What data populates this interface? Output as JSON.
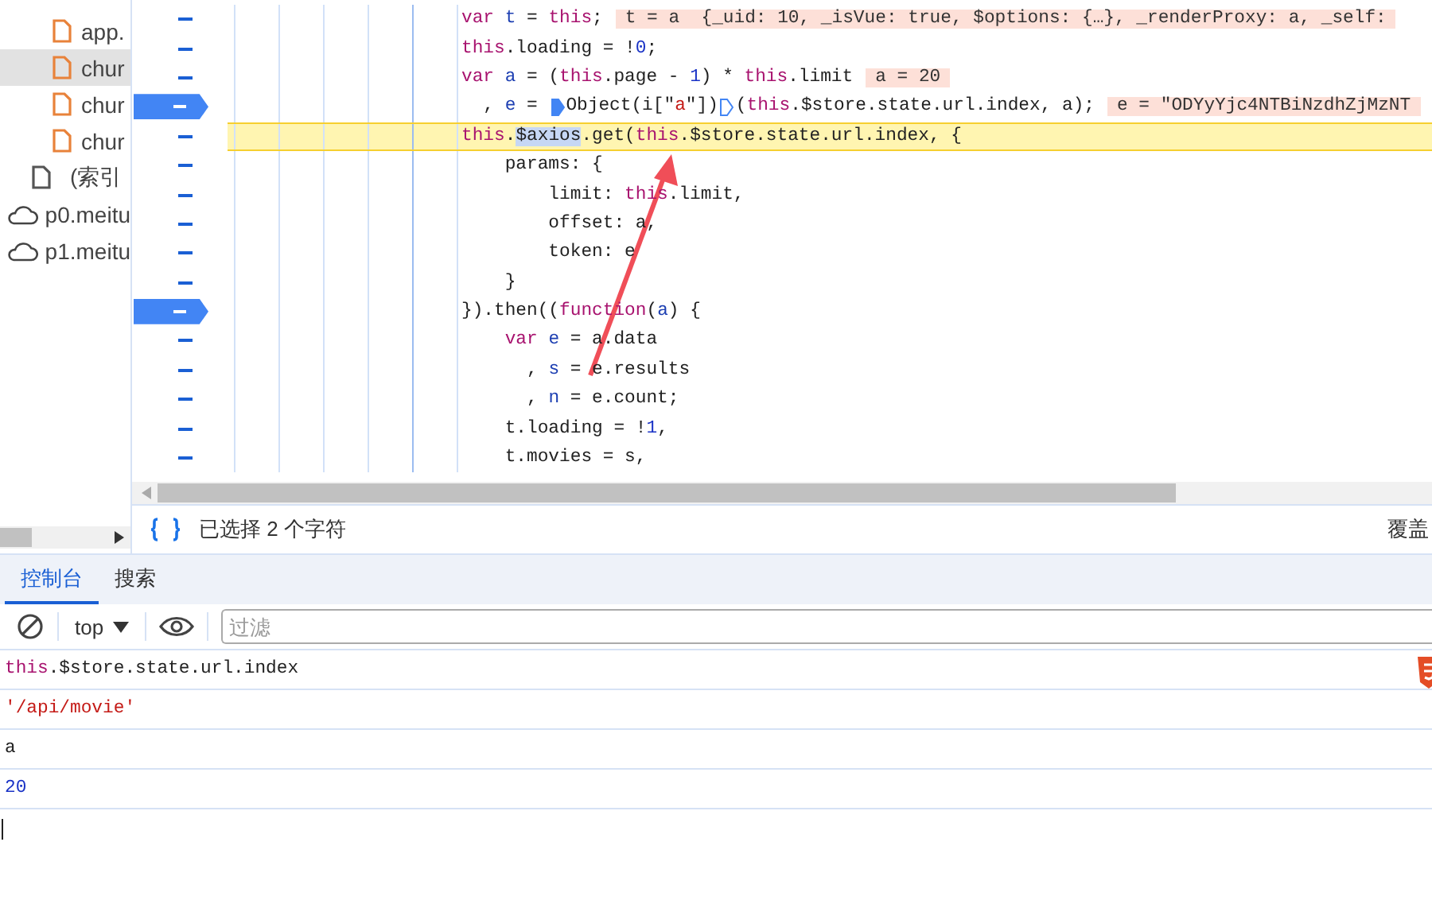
{
  "sidebar": {
    "items": [
      {
        "label": "app.",
        "kind": "script",
        "selected": false
      },
      {
        "label": "chur",
        "kind": "script",
        "selected": true
      },
      {
        "label": "chur",
        "kind": "script",
        "selected": false
      },
      {
        "label": "chur",
        "kind": "script",
        "selected": false
      },
      {
        "label": "(索引",
        "kind": "document",
        "selected": false
      },
      {
        "label": "p0.meitu",
        "kind": "domain",
        "selected": false
      },
      {
        "label": "p1.meitu",
        "kind": "domain",
        "selected": false
      }
    ]
  },
  "editor": {
    "lines": [
      {
        "breakpoint": false,
        "paused": false,
        "tokens": [
          {
            "text": "var ",
            "kind": "kw"
          },
          {
            "text": "t",
            "kind": "id"
          },
          {
            "text": " = ",
            "kind": "plain"
          },
          {
            "text": "this",
            "kind": "kw"
          },
          {
            "text": ";",
            "kind": "plain"
          },
          {
            "text": "t = a  {_uid: 10, _isVue: true, $options: {…}, _renderProxy: a, _self:",
            "kind": "value"
          }
        ]
      },
      {
        "breakpoint": false,
        "paused": false,
        "tokens": [
          {
            "text": "this",
            "kind": "kw"
          },
          {
            "text": ".loading = !",
            "kind": "plain"
          },
          {
            "text": "0",
            "kind": "num"
          },
          {
            "text": ";",
            "kind": "plain"
          }
        ]
      },
      {
        "breakpoint": false,
        "paused": false,
        "tokens": [
          {
            "text": "var ",
            "kind": "kw"
          },
          {
            "text": "a",
            "kind": "id"
          },
          {
            "text": " = (",
            "kind": "plain"
          },
          {
            "text": "this",
            "kind": "kw"
          },
          {
            "text": ".page - ",
            "kind": "plain"
          },
          {
            "text": "1",
            "kind": "num"
          },
          {
            "text": ") * ",
            "kind": "plain"
          },
          {
            "text": "this",
            "kind": "kw"
          },
          {
            "text": ".limit",
            "kind": "plain"
          },
          {
            "text": "a = 20",
            "kind": "value"
          }
        ]
      },
      {
        "breakpoint": true,
        "paused": false,
        "tokens": [
          {
            "text": "  , ",
            "kind": "plain"
          },
          {
            "text": "e",
            "kind": "id"
          },
          {
            "text": " = ",
            "kind": "plain"
          },
          {
            "kind": "stop",
            "active": true
          },
          {
            "text": "Object(i[\"",
            "kind": "plain"
          },
          {
            "text": "a",
            "kind": "str"
          },
          {
            "text": "\"])",
            "kind": "plain"
          },
          {
            "kind": "stop",
            "active": false
          },
          {
            "text": "(",
            "kind": "plain"
          },
          {
            "text": "this",
            "kind": "kw"
          },
          {
            "text": ".$store.state.url.index, a);",
            "kind": "plain"
          },
          {
            "text": "e = \"ODYyYjc4NTBiNzdhZjMzNT",
            "kind": "value"
          }
        ]
      },
      {
        "breakpoint": false,
        "paused": true,
        "tokens": [
          {
            "text": "this",
            "kind": "kw"
          },
          {
            "text": ".",
            "kind": "plain"
          },
          {
            "text": "$axios",
            "kind": "sel"
          },
          {
            "text": ".get(",
            "kind": "plain"
          },
          {
            "text": "this",
            "kind": "kw"
          },
          {
            "text": ".$store.state.url.index, {",
            "kind": "plain"
          }
        ]
      },
      {
        "breakpoint": false,
        "paused": false,
        "tokens": [
          {
            "text": "    params: {",
            "kind": "plain"
          }
        ]
      },
      {
        "breakpoint": false,
        "paused": false,
        "tokens": [
          {
            "text": "        limit: ",
            "kind": "plain"
          },
          {
            "text": "this",
            "kind": "kw"
          },
          {
            "text": ".limit,",
            "kind": "plain"
          }
        ]
      },
      {
        "breakpoint": false,
        "paused": false,
        "tokens": [
          {
            "text": "        offset: a,",
            "kind": "plain"
          }
        ]
      },
      {
        "breakpoint": false,
        "paused": false,
        "tokens": [
          {
            "text": "        token: e",
            "kind": "plain"
          }
        ]
      },
      {
        "breakpoint": false,
        "paused": false,
        "tokens": [
          {
            "text": "    }",
            "kind": "plain"
          }
        ]
      },
      {
        "breakpoint": true,
        "paused": false,
        "tokens": [
          {
            "text": "}).then((",
            "kind": "plain"
          },
          {
            "text": "function",
            "kind": "kw"
          },
          {
            "text": "(",
            "kind": "plain"
          },
          {
            "text": "a",
            "kind": "id"
          },
          {
            "text": ") {",
            "kind": "plain"
          }
        ]
      },
      {
        "breakpoint": false,
        "paused": false,
        "tokens": [
          {
            "text": "    var ",
            "kind": "kw"
          },
          {
            "text": "e",
            "kind": "id"
          },
          {
            "text": " = a.data",
            "kind": "plain"
          }
        ]
      },
      {
        "breakpoint": false,
        "paused": false,
        "tokens": [
          {
            "text": "      , ",
            "kind": "plain"
          },
          {
            "text": "s",
            "kind": "id"
          },
          {
            "text": " = e.results",
            "kind": "plain"
          }
        ]
      },
      {
        "breakpoint": false,
        "paused": false,
        "tokens": [
          {
            "text": "      , ",
            "kind": "plain"
          },
          {
            "text": "n",
            "kind": "id"
          },
          {
            "text": " = e.count;",
            "kind": "plain"
          }
        ]
      },
      {
        "breakpoint": false,
        "paused": false,
        "tokens": [
          {
            "text": "    t.loading = !",
            "kind": "plain"
          },
          {
            "text": "1",
            "kind": "num"
          },
          {
            "text": ",",
            "kind": "plain"
          }
        ]
      },
      {
        "breakpoint": false,
        "paused": false,
        "tokens": [
          {
            "text": "    t.movies = s,",
            "kind": "plain"
          }
        ]
      }
    ]
  },
  "status_bar": {
    "selection": "已选择 2 个字符",
    "coverage": "覆盖"
  },
  "tabs": [
    {
      "label": "控制台",
      "selected": true
    },
    {
      "label": "搜索",
      "selected": false
    }
  ],
  "console_toolbar": {
    "context": "top",
    "filter": {
      "placeholder": "过滤"
    }
  },
  "console": [
    {
      "kind": "input",
      "tokens": [
        {
          "text": "this",
          "kind": "kw"
        },
        {
          "text": ".$store.state.url.index",
          "kind": "plain"
        }
      ]
    },
    {
      "kind": "string",
      "tokens": [
        {
          "text": "'/api/movie'",
          "kind": "plain"
        }
      ]
    },
    {
      "kind": "input",
      "tokens": [
        {
          "text": "a",
          "kind": "plain"
        }
      ]
    },
    {
      "kind": "number",
      "tokens": [
        {
          "text": "20",
          "kind": "plain"
        }
      ]
    }
  ]
}
